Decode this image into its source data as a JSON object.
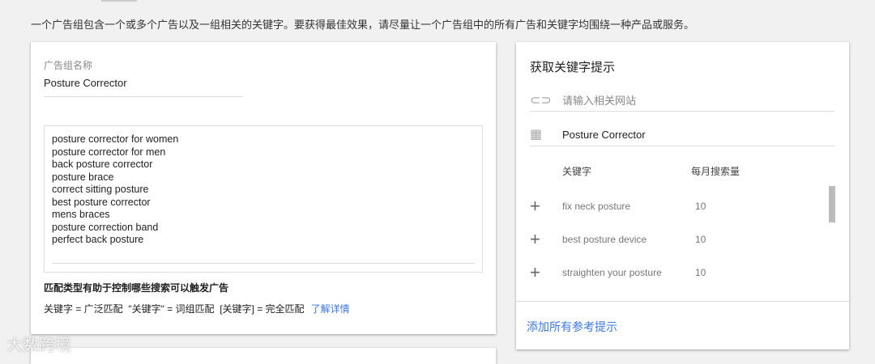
{
  "intro": "一个广告组包含一个或多个广告以及一组相关的关键字。要获得最佳效果，请尽量让一个广告组中的所有广告和关键字均围绕一种产品或服务。",
  "ad_group": {
    "label": "广告组名称",
    "value": "Posture Corrector"
  },
  "keywords": [
    "posture corrector for women",
    "posture corrector for men",
    "back posture corrector",
    "posture brace",
    "correct sitting posture",
    "best posture corrector",
    "mens braces",
    "posture correction band",
    "perfect back posture"
  ],
  "match": {
    "title": "匹配类型有助于控制哪些搜索可以触发广告",
    "desc": "关键字 = 广泛匹配  \"关键字\" = 词组匹配  [关键字] = 完全匹配",
    "link": "了解详情"
  },
  "suggest": {
    "title": "获取关键字提示",
    "website_placeholder": "请输入相关网站",
    "product": "Posture Corrector",
    "col_keyword": "关键字",
    "col_volume": "每月搜索量",
    "rows": [
      {
        "keyword": "fix neck posture",
        "volume": "10"
      },
      {
        "keyword": "best posture device",
        "volume": "10"
      },
      {
        "keyword": "straighten your posture",
        "volume": "10"
      }
    ],
    "add_all": "添加所有参考提示"
  },
  "watermark": "大数跨境"
}
